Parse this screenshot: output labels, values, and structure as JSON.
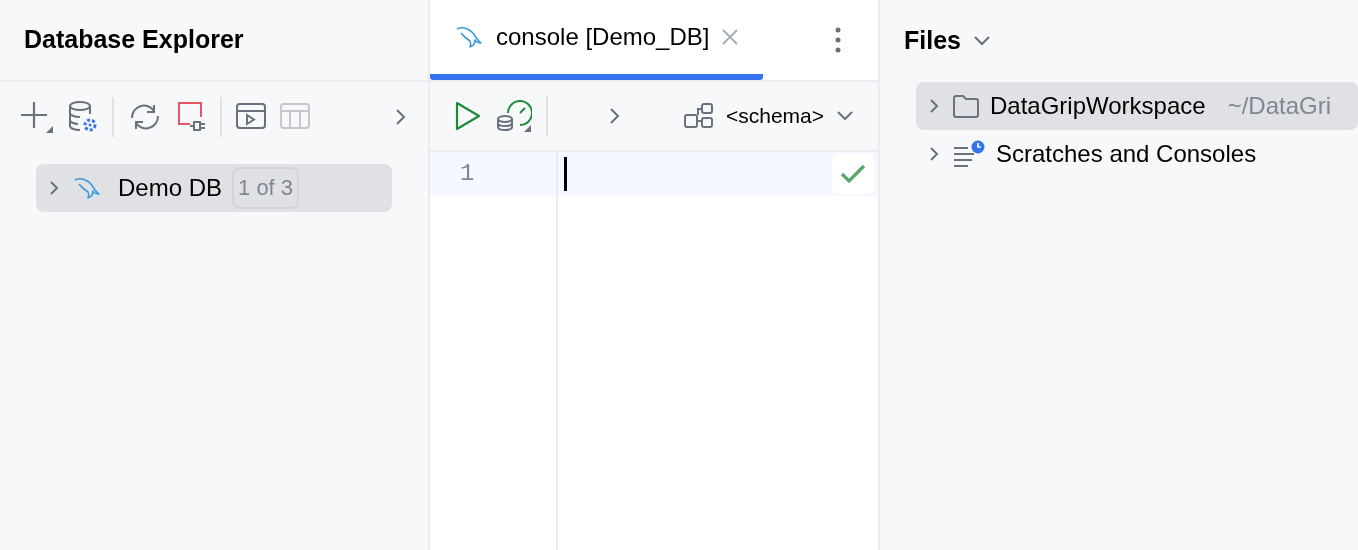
{
  "left_panel": {
    "title": "Database Explorer",
    "tree": [
      {
        "label": "Demo DB",
        "badge": "1 of 3",
        "selected": true,
        "expanded": false
      }
    ]
  },
  "editor": {
    "tabs": [
      {
        "label": "console [Demo_DB]",
        "selected": true
      }
    ],
    "schema_selector": "<schema>",
    "line_numbers": [
      "1"
    ]
  },
  "files_panel": {
    "title": "Files",
    "tree": [
      {
        "kind": "folder",
        "label": "DataGripWorkspace",
        "path": "~/DataGri",
        "selected": true,
        "expanded": false
      },
      {
        "kind": "scratches",
        "label": "Scratches and Consoles",
        "selected": false,
        "expanded": false
      }
    ]
  }
}
